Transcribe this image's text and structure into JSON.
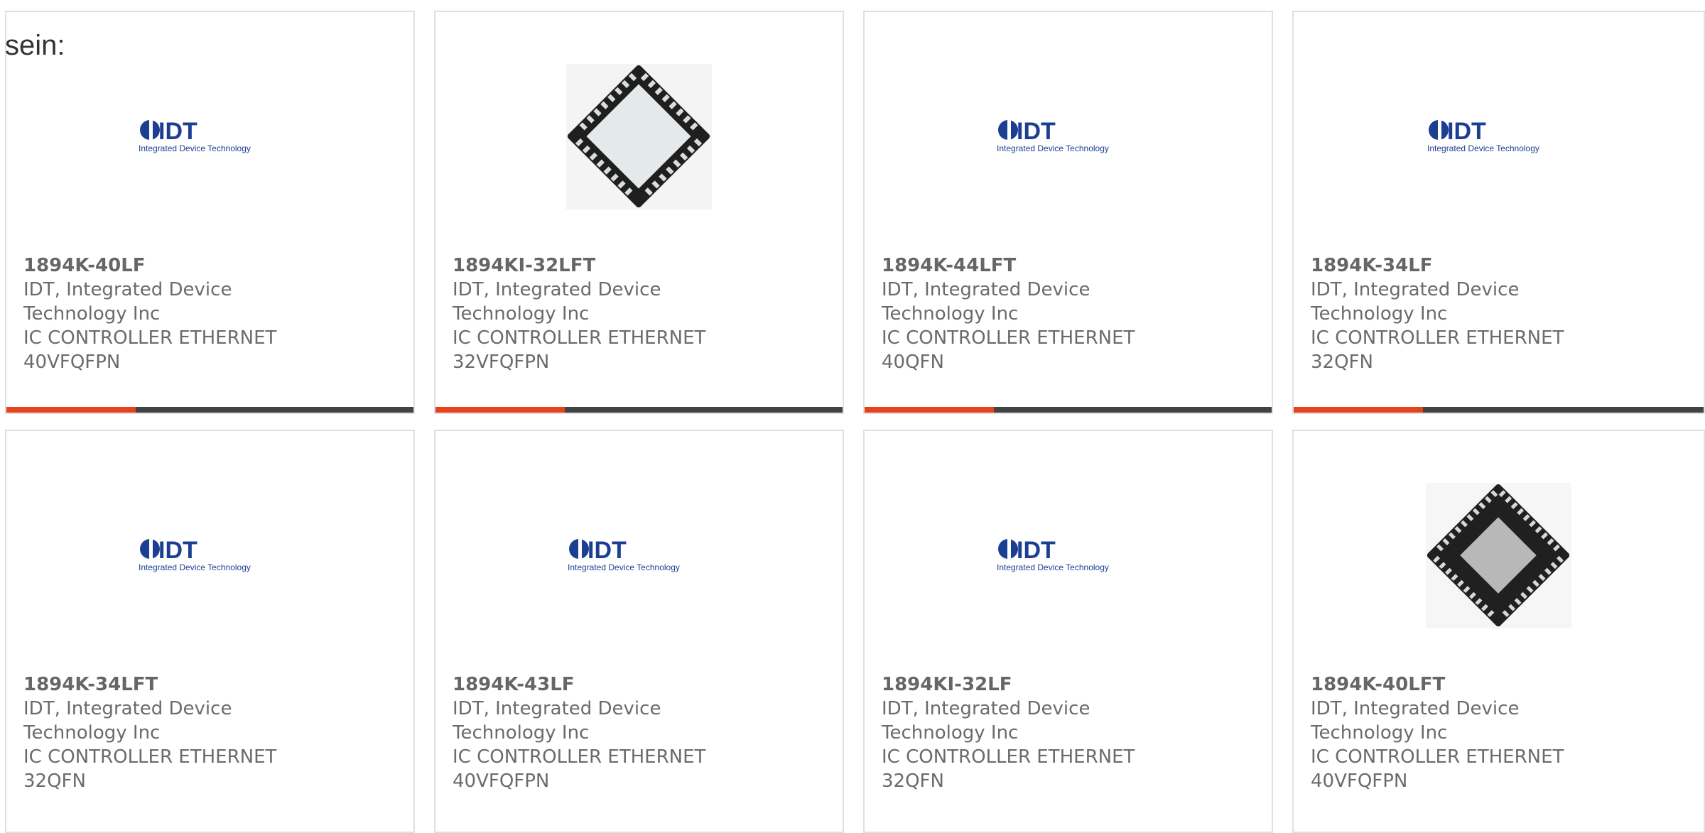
{
  "intro_text": "sein:",
  "colors": {
    "accent": "#e8421a",
    "bar": "#424242",
    "text": "#6b6b6b",
    "logo_blue": "#1c3f94"
  },
  "logo": {
    "wordmark": "IDT",
    "tagline": "Integrated Device Technology"
  },
  "products": [
    {
      "part": "1894K-40LF",
      "manufacturer_line1": "IDT, Integrated Device",
      "manufacturer_line2": "Technology Inc",
      "desc_line1": "IC CONTROLLER ETHERNET",
      "desc_line2": "40VFQFPN",
      "image": "idt-logo"
    },
    {
      "part": "1894KI-32LFT",
      "manufacturer_line1": "IDT, Integrated Device",
      "manufacturer_line2": "Technology Inc",
      "desc_line1": "IC CONTROLLER ETHERNET",
      "desc_line2": "32VFQFPN",
      "image": "chip-32"
    },
    {
      "part": "1894K-44LFT",
      "manufacturer_line1": "IDT, Integrated Device",
      "manufacturer_line2": "Technology Inc",
      "desc_line1": "IC CONTROLLER ETHERNET",
      "desc_line2": "40QFN",
      "image": "idt-logo"
    },
    {
      "part": "1894K-34LF",
      "manufacturer_line1": "IDT, Integrated Device",
      "manufacturer_line2": "Technology Inc",
      "desc_line1": "IC CONTROLLER ETHERNET",
      "desc_line2": "32QFN",
      "image": "idt-logo"
    },
    {
      "part": "1894K-34LFT",
      "manufacturer_line1": "IDT, Integrated Device",
      "manufacturer_line2": "Technology Inc",
      "desc_line1": "IC CONTROLLER ETHERNET",
      "desc_line2": "32QFN",
      "image": "idt-logo"
    },
    {
      "part": "1894K-43LF",
      "manufacturer_line1": "IDT, Integrated Device",
      "manufacturer_line2": "Technology Inc",
      "desc_line1": "IC CONTROLLER ETHERNET",
      "desc_line2": "40VFQFPN",
      "image": "idt-logo"
    },
    {
      "part": "1894KI-32LF",
      "manufacturer_line1": "IDT, Integrated Device",
      "manufacturer_line2": "Technology Inc",
      "desc_line1": "IC CONTROLLER ETHERNET",
      "desc_line2": "32QFN",
      "image": "idt-logo"
    },
    {
      "part": "1894K-40LFT",
      "manufacturer_line1": "IDT, Integrated Device",
      "manufacturer_line2": "Technology Inc",
      "desc_line1": "IC CONTROLLER ETHERNET",
      "desc_line2": "40VFQFPN",
      "image": "chip-40"
    }
  ]
}
